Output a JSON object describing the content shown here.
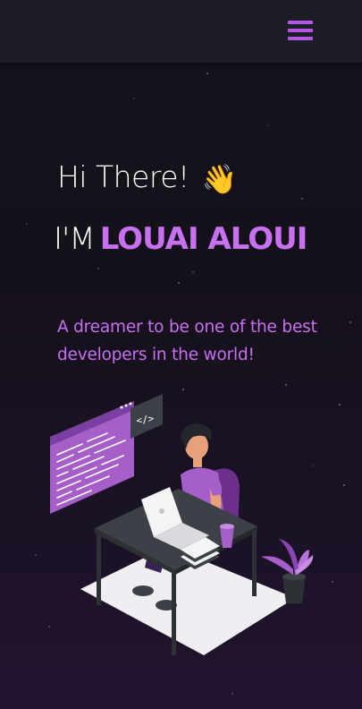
{
  "navbar": {
    "menu_icon": "hamburger-menu-icon",
    "accent": "#b457e6"
  },
  "hero": {
    "greeting": "Hi There!",
    "wave_emoji": "👋",
    "intro_prefix": "I'M",
    "name": "LOUAI ALOUI",
    "tagline": "A dreamer to be one of the best developers in the world!",
    "code_tag": "</>"
  },
  "colors": {
    "background": "#14121a",
    "accent": "#c770f0",
    "text": "#ffffff"
  }
}
